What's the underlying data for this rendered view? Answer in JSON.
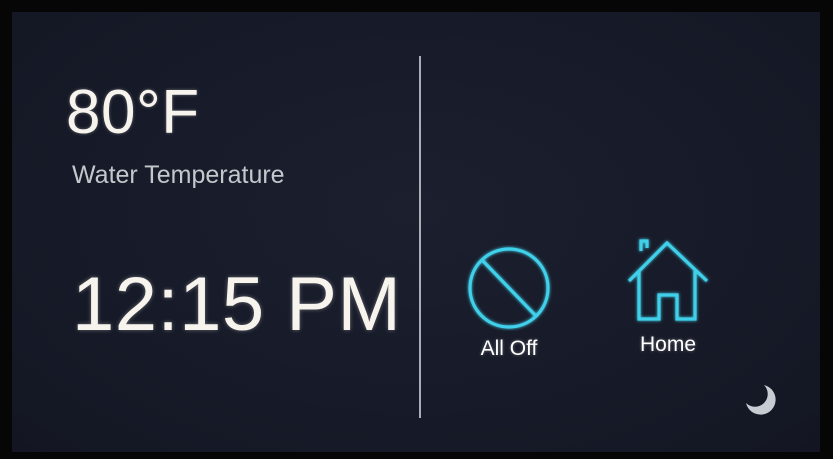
{
  "status": {
    "temperature": "80°F",
    "temperature_label": "Water Temperature",
    "time": "12:15 PM"
  },
  "actions": [
    {
      "label": "All Off",
      "icon": "prohibited-icon"
    },
    {
      "label": "Home",
      "icon": "house-icon"
    }
  ],
  "night_mode": {
    "icon": "crescent-moon-icon"
  },
  "colors": {
    "background": "#171b29",
    "accent": "#3fd0ea",
    "text": "#f7f4ee",
    "secondary_text": "#c3c8cc"
  }
}
